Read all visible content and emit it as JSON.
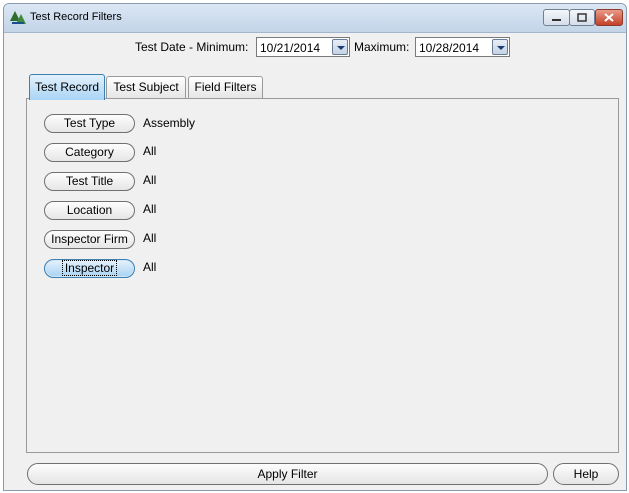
{
  "window": {
    "title": "Test Record Filters"
  },
  "dates": {
    "min_label": "Test Date - Minimum:",
    "min_value": "10/21/2014",
    "max_label": "Maximum:",
    "max_value": "10/28/2014"
  },
  "tabs": [
    {
      "label": "Test Record",
      "active": true
    },
    {
      "label": "Test Subject",
      "active": false
    },
    {
      "label": "Field Filters",
      "active": false
    }
  ],
  "filters": [
    {
      "label": "Test Type",
      "value": "Assembly"
    },
    {
      "label": "Category",
      "value": "All"
    },
    {
      "label": "Test Title",
      "value": "All"
    },
    {
      "label": "Location",
      "value": "All"
    },
    {
      "label": "Inspector Firm",
      "value": "All"
    },
    {
      "label": "Inspector",
      "value": "All",
      "focused": true
    }
  ],
  "footer": {
    "apply_label": "Apply Filter",
    "help_label": "Help"
  },
  "icons": {
    "app": "pine-tree-icon",
    "minimize": "minimize-icon",
    "maximize": "maximize-icon",
    "close": "close-icon",
    "dropdown": "chevron-down-icon"
  },
  "colors": {
    "accent": "#3c7fb1",
    "active_tab": "#a9d4f5",
    "close": "#c3402b"
  }
}
